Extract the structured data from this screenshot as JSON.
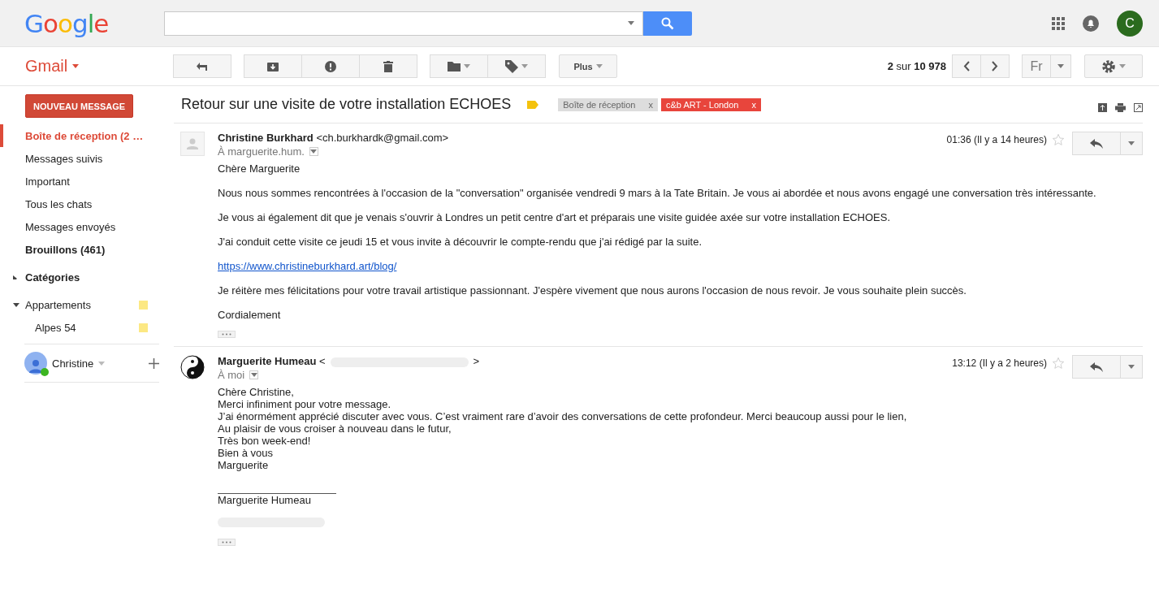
{
  "header": {
    "logo": "Google",
    "avatar": "C"
  },
  "toolbar": {
    "app": "Gmail",
    "more": "Plus",
    "counter": "**2** sur **10 978**",
    "language": "Fr"
  },
  "sidebar": {
    "compose": "NOUVEAU MESSAGE",
    "items": [
      {
        "label": "Boîte de réception (2 …",
        "selected": true,
        "bold": true
      },
      {
        "label": "Messages suivis",
        "selected": false,
        "bold": false
      },
      {
        "label": "Important",
        "selected": false,
        "bold": false
      },
      {
        "label": "Tous les chats",
        "selected": false,
        "bold": false
      },
      {
        "label": "Messages envoyés",
        "selected": false,
        "bold": false
      },
      {
        "label": "Brouillons (461)",
        "selected": false,
        "bold": true
      }
    ],
    "groups": [
      {
        "label": "Catégories",
        "expanded": false
      },
      {
        "label": "Appartements",
        "expanded": true,
        "color": "#fce883",
        "children": [
          {
            "label": "Alpes 54",
            "color": "#fce883"
          }
        ]
      }
    ],
    "chat_user": "Christine"
  },
  "thread": {
    "subject": "Retour sur une visite de votre installation ECHOES",
    "labels": [
      {
        "text": "Boîte de réception",
        "remove": "x",
        "color": "#dddddd"
      },
      {
        "text": "c&b ART - London",
        "remove": "x",
        "color": "#e8453c"
      }
    ],
    "messages": [
      {
        "sender": "Christine Burkhard",
        "email": "<ch.burkhardk@gmail.com>",
        "to": "À marguerite.hum.",
        "time": "01:36 (Il y a 14 heures)",
        "starred": false,
        "kind": "letter",
        "blocks": [
          {
            "kind": "text",
            "text": "Chère Marguerite"
          },
          {
            "kind": "text",
            "text": "Nous nous sommes rencontrées à l'occasion de la \"conversation\" organisée vendredi 9 mars à la Tate Britain. Je vous ai abordée et nous avons engagé une conversation très intéressante."
          },
          {
            "kind": "text",
            "text": "Je vous ai également dit que je venais s'ouvrir à Londres un petit centre d'art et préparais une visite guidée axée sur votre installation ECHOES."
          },
          {
            "kind": "text",
            "text": "J'ai conduit cette visite ce jeudi 15 et vous invite à découvrir le compte-rendu que j'ai rédigé par la suite."
          },
          {
            "kind": "link",
            "text": "https://www.christineburkhard.art/blog/"
          },
          {
            "kind": "text",
            "text": "Je réitère mes félicitations pour votre travail artistique passionnant. J'espère vivement que nous aurons l'occasion de nous revoir. Je vous souhaite plein succès."
          },
          {
            "kind": "text",
            "text": "Cordialement"
          }
        ]
      },
      {
        "sender": "Marguerite Humeau",
        "email_open": "<",
        "email_close": ">",
        "to": "À moi",
        "time": "13:12 (Il y a 2 heures)",
        "starred": false,
        "kind": "reply",
        "blocks": [
          {
            "kind": "text",
            "text": "Chère Christine,"
          },
          {
            "kind": "text",
            "text": "Merci infiniment pour votre message."
          },
          {
            "kind": "text",
            "text": "J’ai énormément apprécié discuter avec vous. C’est vraiment rare d’avoir des conversations de cette profondeur. Merci beaucoup aussi pour le lien,"
          },
          {
            "kind": "text",
            "text": "Au plaisir de vous croiser à nouveau dans le futur,"
          },
          {
            "kind": "text",
            "text": "Très bon week-end!"
          },
          {
            "kind": "text",
            "text": "Bien à vous"
          },
          {
            "kind": "text",
            "text": "Marguerite"
          },
          {
            "kind": "rule"
          },
          {
            "kind": "text",
            "text": "Marguerite Humeau"
          },
          {
            "kind": "redacted"
          }
        ]
      }
    ]
  }
}
